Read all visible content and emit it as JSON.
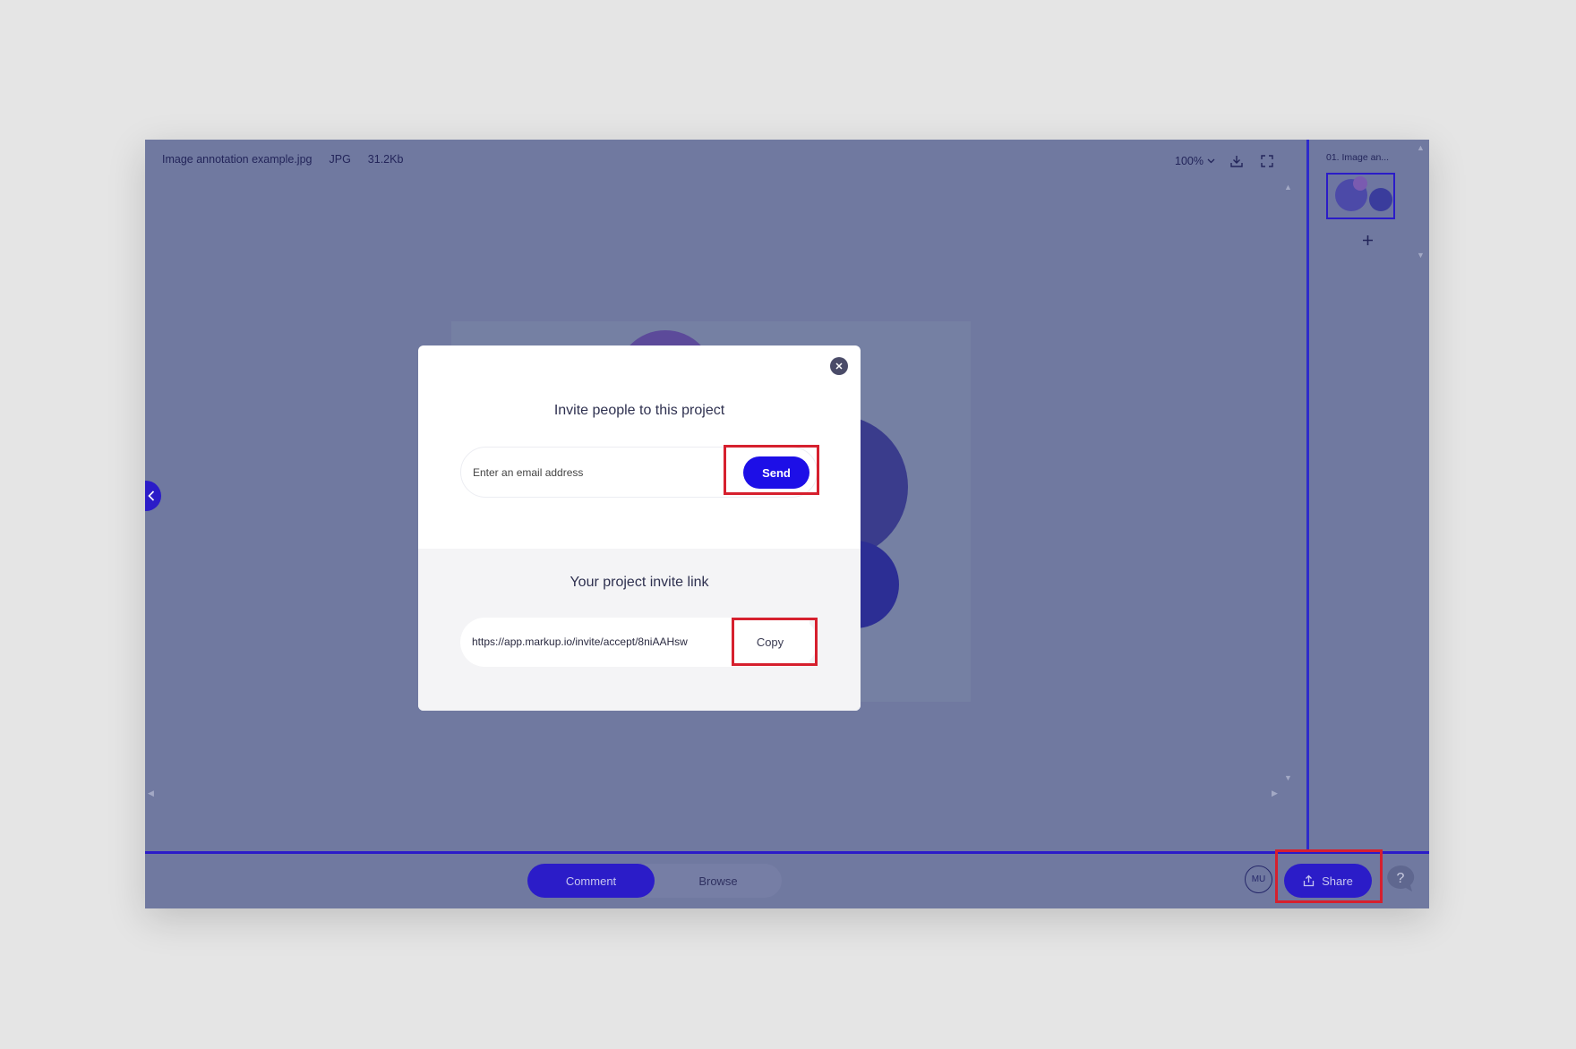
{
  "file": {
    "name": "Image annotation example.jpg",
    "type": "JPG",
    "size": "31.2Kb"
  },
  "toolbar": {
    "zoom_label": "100%",
    "icons": [
      "chevron-down-icon",
      "download-icon",
      "fullscreen-icon"
    ]
  },
  "pages_panel": {
    "items": [
      {
        "label": "01. Image an..."
      }
    ],
    "add_icon": "plus-icon"
  },
  "bottom_bar": {
    "modes": [
      {
        "label": "Comment",
        "active": true
      },
      {
        "label": "Browse",
        "active": false
      }
    ],
    "avatar_initials": "MU",
    "share_label": "Share",
    "help_icon": "question-chat-icon"
  },
  "modal": {
    "title": "Invite people to this project",
    "email_placeholder": "Enter an email address",
    "send_label": "Send",
    "invite_title": "Your project invite link",
    "invite_link": "https://app.markup.io/invite/accept/8niAAHsw",
    "copy_label": "Copy",
    "close_icon": "close-icon"
  },
  "colors": {
    "accent": "#2b1cc8",
    "send_button": "#1d0fe7",
    "overlay_bg": "#7079a0",
    "highlight": "#d6202e",
    "page_bg": "#e5e5e5"
  }
}
